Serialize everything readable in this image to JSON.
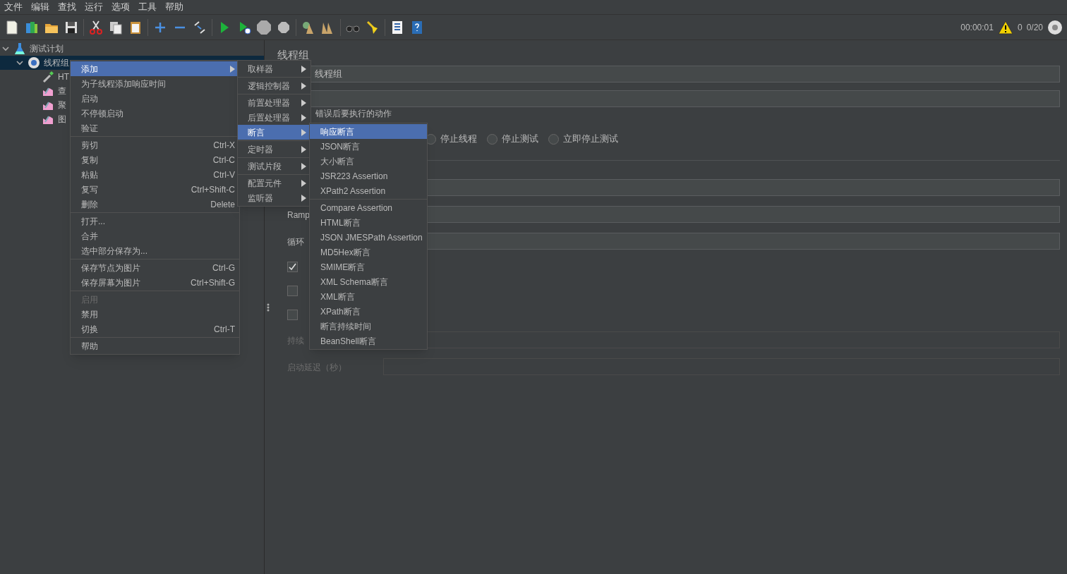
{
  "menu_bar": [
    "文件",
    "编辑",
    "查找",
    "运行",
    "选项",
    "工具",
    "帮助"
  ],
  "status": {
    "elapsed": "00:00:01",
    "warnings": "0",
    "threads": "0/20"
  },
  "tree": [
    {
      "label": "测试计划",
      "kind": "plan",
      "expanded": true,
      "selected": false,
      "children": [
        {
          "label": "线程组",
          "kind": "threads",
          "expanded": true,
          "selected": true,
          "children": [
            {
              "label": "HT",
              "kind": "sampler",
              "selected": false
            },
            {
              "label": "查",
              "kind": "listener",
              "selected": false
            },
            {
              "label": "聚",
              "kind": "listener",
              "selected": false
            },
            {
              "label": "图",
              "kind": "listener",
              "selected": false
            }
          ]
        }
      ]
    }
  ],
  "panel": {
    "title": "线程组",
    "name_value": "线程组",
    "error_action_label": "错误后要执行的动作",
    "radios": [
      {
        "label": "停止线程",
        "selected": false
      },
      {
        "label": "停止测试",
        "selected": false
      },
      {
        "label": "立即停止测试",
        "selected": false
      }
    ],
    "rows": [
      {
        "kind": "field",
        "label": ""
      },
      {
        "kind": "field",
        "label": "Ramp",
        "disabled": false
      },
      {
        "kind": "field",
        "label": "循环",
        "disabled": false
      },
      {
        "kind": "checkbox",
        "checked": true
      },
      {
        "kind": "checkbox",
        "checked": false
      },
      {
        "kind": "checkbox",
        "checked": false
      },
      {
        "kind": "field",
        "label": "持续",
        "disabled": true
      },
      {
        "kind": "field",
        "label": "启动延迟（秒）",
        "disabled": true
      }
    ]
  },
  "context_menu": [
    [
      {
        "label": "添加",
        "selected": true,
        "disabled": false,
        "submenu": true
      },
      {
        "label": "为子线程添加响应时间",
        "selected": false,
        "disabled": false
      },
      {
        "label": "启动",
        "selected": false,
        "disabled": false
      },
      {
        "label": "不停顿启动",
        "selected": false,
        "disabled": false
      },
      {
        "label": "验证",
        "selected": false,
        "disabled": false
      }
    ],
    [
      {
        "label": "剪切",
        "shortcut": "Ctrl-X",
        "selected": false,
        "disabled": false
      },
      {
        "label": "复制",
        "shortcut": "Ctrl-C",
        "selected": false,
        "disabled": false
      },
      {
        "label": "粘贴",
        "shortcut": "Ctrl-V",
        "selected": false,
        "disabled": false
      },
      {
        "label": "复写",
        "shortcut": "Ctrl+Shift-C",
        "selected": false,
        "disabled": false
      },
      {
        "label": "删除",
        "shortcut": "Delete",
        "selected": false,
        "disabled": false
      }
    ],
    [
      {
        "label": "打开...",
        "selected": false,
        "disabled": false
      },
      {
        "label": "合并",
        "selected": false,
        "disabled": false
      },
      {
        "label": "选中部分保存为...",
        "selected": false,
        "disabled": false
      }
    ],
    [
      {
        "label": "保存节点为图片",
        "shortcut": "Ctrl-G",
        "selected": false,
        "disabled": false
      },
      {
        "label": "保存屏幕为图片",
        "shortcut": "Ctrl+Shift-G",
        "selected": false,
        "disabled": false
      }
    ],
    [
      {
        "label": "启用",
        "selected": false,
        "disabled": true
      },
      {
        "label": "禁用",
        "selected": false,
        "disabled": false
      },
      {
        "label": "切换",
        "shortcut": "Ctrl-T",
        "selected": false,
        "disabled": false
      }
    ],
    [
      {
        "label": "帮助",
        "selected": false,
        "disabled": false
      }
    ]
  ],
  "add_submenu": [
    [
      {
        "label": "取样器",
        "selected": false
      }
    ],
    [
      {
        "label": "逻辑控制器",
        "selected": false
      }
    ],
    [
      {
        "label": "前置处理器",
        "selected": false
      },
      {
        "label": "后置处理器",
        "selected": false
      },
      {
        "label": "断言",
        "selected": true
      }
    ],
    [
      {
        "label": "定时器",
        "selected": false
      }
    ],
    [
      {
        "label": "测试片段",
        "selected": false
      }
    ],
    [
      {
        "label": "配置元件",
        "selected": false
      },
      {
        "label": "监听器",
        "selected": false
      }
    ]
  ],
  "assertion_submenu": [
    [
      {
        "label": "响应断言",
        "selected": true
      },
      {
        "label": "JSON断言",
        "selected": false
      },
      {
        "label": "大小断言",
        "selected": false
      },
      {
        "label": "JSR223 Assertion",
        "selected": false
      },
      {
        "label": "XPath2 Assertion",
        "selected": false
      }
    ],
    [
      {
        "label": "Compare Assertion",
        "selected": false
      },
      {
        "label": "HTML断言",
        "selected": false
      },
      {
        "label": "JSON JMESPath Assertion",
        "selected": false
      },
      {
        "label": "MD5Hex断言",
        "selected": false
      },
      {
        "label": "SMIME断言",
        "selected": false
      },
      {
        "label": "XML Schema断言",
        "selected": false
      },
      {
        "label": "XML断言",
        "selected": false
      },
      {
        "label": "XPath断言",
        "selected": false
      },
      {
        "label": "断言持续时间",
        "selected": false
      },
      {
        "label": "BeanShell断言",
        "selected": false
      }
    ]
  ]
}
